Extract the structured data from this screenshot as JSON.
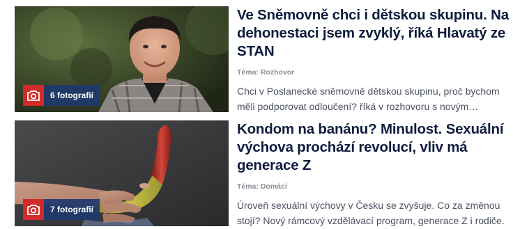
{
  "articles": [
    {
      "photo_count": "6 fotografií",
      "title": "Ve Sněmovně chci i dětskou skupinu. Na dehonestaci jsem zvyklý, říká Hlavatý ze STAN",
      "tema_label": "Téma: ",
      "tema_value": "Rozhovor",
      "perex": "Chci v Poslanecké sněmovně dětskou skupinu, proč bychom měli podporovat odloučení? říká v rozhovoru s novým poslancem Hlavatým.",
      "badge_icon": "camera-icon"
    },
    {
      "photo_count": "7 fotografií",
      "title": "Kondom na banánu? Minulost. Sexuální výchova prochází revolucí, vliv má generace Z",
      "tema_label": "Téma: ",
      "tema_value": "Domácí",
      "perex": "Úroveň sexuální výchovy v Česku se zvyšuje. Co za změnou stojí? Nový rámcový vzdělávací program, generace Z i rodiče.",
      "badge_icon": "camera-icon"
    }
  ],
  "colors": {
    "badge_camera_bg": "#d32a2a",
    "badge_count_bg": "#1e3a6e",
    "headline": "#0f1c3f",
    "tema": "#8a8f98",
    "perex": "#4b5160"
  }
}
